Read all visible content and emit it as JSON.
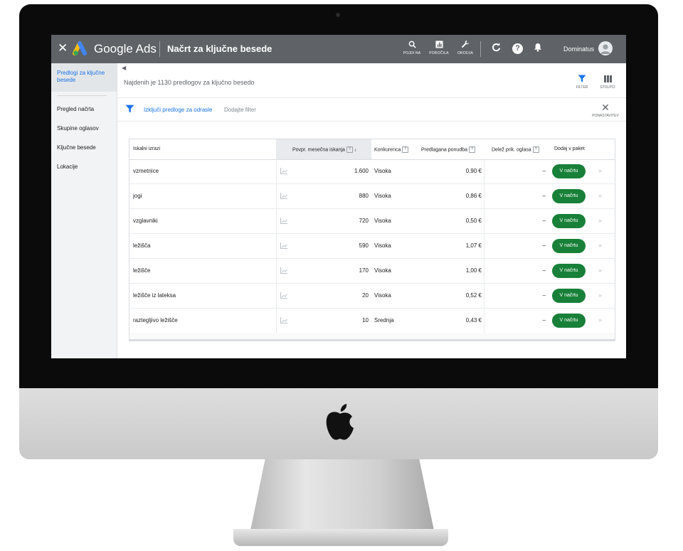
{
  "topbar": {
    "brand": "Google Ads",
    "title": "Načrt za ključne besede",
    "tools": [
      {
        "icon": "search-icon",
        "label": "POJDI NA"
      },
      {
        "icon": "reports-icon",
        "label": "POROČILA"
      },
      {
        "icon": "wrench-icon",
        "label": "ORODJA"
      }
    ],
    "user": "Dominatus"
  },
  "sidebar": {
    "active": "Predlogi za ključne besede",
    "items": [
      "Pregled načrta",
      "Skupine oglasov",
      "Ključne besede",
      "Lokacije"
    ]
  },
  "toolbar": {
    "count_text": "Najdenih je 1130 predlogov za ključno besedo",
    "filter_label": "FILTER",
    "columns_label": "STOLPCI"
  },
  "filters": {
    "active": "Izključi predloge za odrasle",
    "add": "Dodajte filter",
    "reset_label": "PONASTAVITEV"
  },
  "table": {
    "headers": {
      "keyword": "Iskalni izrazi",
      "searches": "Povpr. mesečna iskanja",
      "competition": "Konkurenca",
      "bid": "Predlagana ponudba",
      "share": "Delež prik. oglasa",
      "add": "Dodaj v paket"
    },
    "sort_icon": "↓",
    "button_label": "V načrtu",
    "rows": [
      {
        "keyword": "vzmetnice",
        "searches": "1.600",
        "competition": "Visoka",
        "bid": "0,90 €",
        "share": "–"
      },
      {
        "keyword": "jogi",
        "searches": "880",
        "competition": "Visoka",
        "bid": "0,86 €",
        "share": "–"
      },
      {
        "keyword": "vzglavniki",
        "searches": "720",
        "competition": "Visoka",
        "bid": "0,50 €",
        "share": "–"
      },
      {
        "keyword": "ležišča",
        "searches": "590",
        "competition": "Visoka",
        "bid": "1,07 €",
        "share": "–"
      },
      {
        "keyword": "ležišče",
        "searches": "170",
        "competition": "Visoka",
        "bid": "1,00 €",
        "share": "–"
      },
      {
        "keyword": "ležišče iz lateksa",
        "searches": "20",
        "competition": "Visoka",
        "bid": "0,52 €",
        "share": "–"
      },
      {
        "keyword": "raztegljivo ležišče",
        "searches": "10",
        "competition": "Srednja",
        "bid": "0,43 €",
        "share": "–"
      }
    ]
  },
  "colors": {
    "topbar": "#5f6368",
    "accent": "#1a73e8",
    "button": "#188038"
  }
}
